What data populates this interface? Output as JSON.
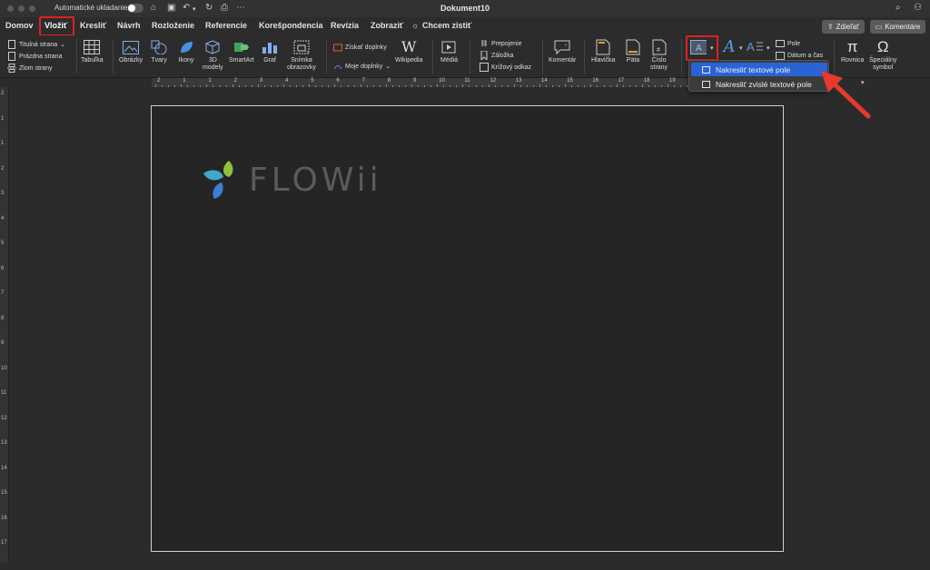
{
  "window": {
    "title": "Dokument10",
    "autosave_label": "Automatické ukladanie"
  },
  "tabs": [
    {
      "label": "Domov"
    },
    {
      "label": "Vložiť"
    },
    {
      "label": "Kresliť"
    },
    {
      "label": "Návrh"
    },
    {
      "label": "Rozloženie"
    },
    {
      "label": "Referencie"
    },
    {
      "label": "Korešpondencia"
    },
    {
      "label": "Revízia"
    },
    {
      "label": "Zobraziť"
    },
    {
      "label": "Chcem zistiť"
    }
  ],
  "actions": {
    "share": "Zdieľať",
    "comments": "Komentáre"
  },
  "ribbon": {
    "pages": {
      "cover": "Titulná strana",
      "blank": "Prázdna strana",
      "break": "Zlom strany"
    },
    "table": "Tabuľka",
    "pictures": "Obrázky",
    "shapes": "Tvary",
    "icons": "Ikony",
    "models_3d": [
      "3D",
      "modely"
    ],
    "smartart": "SmartArt",
    "chart": "Graf",
    "screenshot": [
      "Snímka",
      "obrazovky"
    ],
    "get_addins": "Získať doplnky",
    "my_addins": "Moje doplnky",
    "wikipedia": "Wikipedia",
    "media": "Médiá",
    "link": "Prepojenie",
    "bookmark": "Záložka",
    "crossref": "Krížový odkaz",
    "comment": "Komentár",
    "header": "Hlavička",
    "footer": "Päta",
    "page_number": [
      "Číslo",
      "strany"
    ],
    "field": "Pole",
    "datetime": "Dátum a čas",
    "equation": "Rovnica",
    "symbol": [
      "Špeciálny",
      "symbol"
    ]
  },
  "textbox_menu": {
    "items": [
      {
        "label": "Nakresliť textové pole",
        "selected": true
      },
      {
        "label": "Nakresliť zvislé textové pole",
        "selected": false
      }
    ]
  },
  "ruler": {
    "top_numbers": [
      "2",
      "1",
      "1",
      "2",
      "3",
      "4",
      "5",
      "6",
      "7",
      "8",
      "9",
      "10",
      "11",
      "12",
      "13",
      "14",
      "15",
      "16",
      "17",
      "18",
      "19",
      "20",
      "21",
      "22"
    ],
    "left_numbers": [
      "2",
      "1",
      "1",
      "2",
      "3",
      "4",
      "5",
      "6",
      "7",
      "8",
      "9",
      "10",
      "11",
      "12",
      "13",
      "14",
      "15",
      "16",
      "17",
      "18"
    ]
  },
  "document": {
    "logo_text": "FLOWii"
  },
  "colors": {
    "accent_red": "#e02020",
    "menu_highlight": "#2a63d4",
    "logo_green": "#8fc23f",
    "logo_teal": "#3fa8c8",
    "logo_blue": "#3b7fd0"
  }
}
